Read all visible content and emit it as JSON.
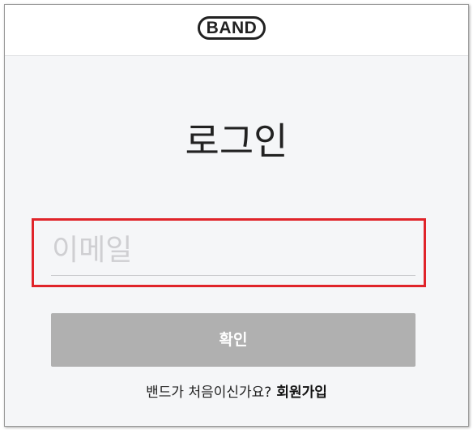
{
  "header": {
    "logo_text": "BAND"
  },
  "login": {
    "title": "로그인",
    "email_placeholder": "이메일",
    "email_value": "",
    "confirm_label": "확인"
  },
  "signup": {
    "question": "밴드가 처음이신가요?",
    "link_label": "회원가입"
  },
  "colors": {
    "highlight_border": "#e0242a",
    "button_disabled_bg": "#b0b0b0",
    "page_bg": "#f5f6f8"
  }
}
